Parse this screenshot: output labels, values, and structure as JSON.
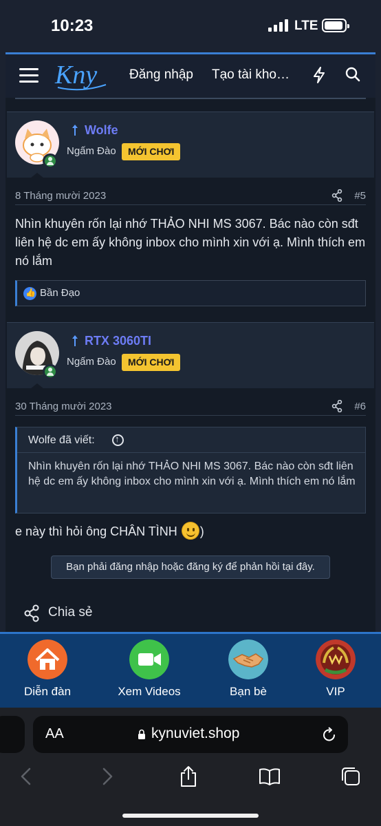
{
  "status_bar": {
    "time": "10:23",
    "network": "LTE",
    "battery_level": 1.0
  },
  "header": {
    "logo_text": "Kny",
    "login_label": "Đăng nhập",
    "register_label": "Tạo tài kho…"
  },
  "posts": [
    {
      "username": "Wolfe",
      "user_title": "Ngấm Đào",
      "badge": "MỚI CHƠI",
      "date": "8 Tháng mười 2023",
      "post_number": "#5",
      "body": "Nhìn khuyên rốn lại nhớ THẢO NHI MS 3067. Bác nào còn sđt liên hệ dc em ấy không inbox cho mình xin với ạ. Mình thích em nó lắm",
      "reaction": "Bần Đạo"
    },
    {
      "username": "RTX 3060TI",
      "user_title": "Ngấm Đào",
      "badge": "MỚI CHƠI",
      "date": "30 Tháng mười 2023",
      "post_number": "#6",
      "quote_author": "Wolfe đã viết:",
      "quote_text": "Nhìn khuyên rốn lại nhớ THẢO NHI MS 3067. Bác nào còn sđt liên hệ dc em ấy không inbox cho mình xin với ạ. Mình thích em nó lắm",
      "body_before_emoji": "e này thì hỏi ông CHÂN TÌNH ",
      "body_after_emoji": ")"
    }
  ],
  "login_notice": "Bạn phải đăng nhập hoặc đăng ký để phản hồi tại đây.",
  "share_label": "Chia sẻ",
  "app_nav": [
    {
      "label": "Diễn đàn",
      "icon": "home-icon",
      "color": "#f06a2c"
    },
    {
      "label": "Xem Videos",
      "icon": "video-camera-icon",
      "color": "#3fc24a"
    },
    {
      "label": "Bạn bè",
      "icon": "handshake-icon",
      "color": "#5bb5c9"
    },
    {
      "label": "VIP",
      "icon": "vip-laurel-icon",
      "color": "#c0392b"
    }
  ],
  "browser": {
    "text_size_label": "AA",
    "url": "kynuviet.shop"
  },
  "colors": {
    "accent": "#3a7fd4",
    "username": "#6d7cf5",
    "badge": "#f4c430",
    "nav_bg": "#0e3b6e"
  }
}
